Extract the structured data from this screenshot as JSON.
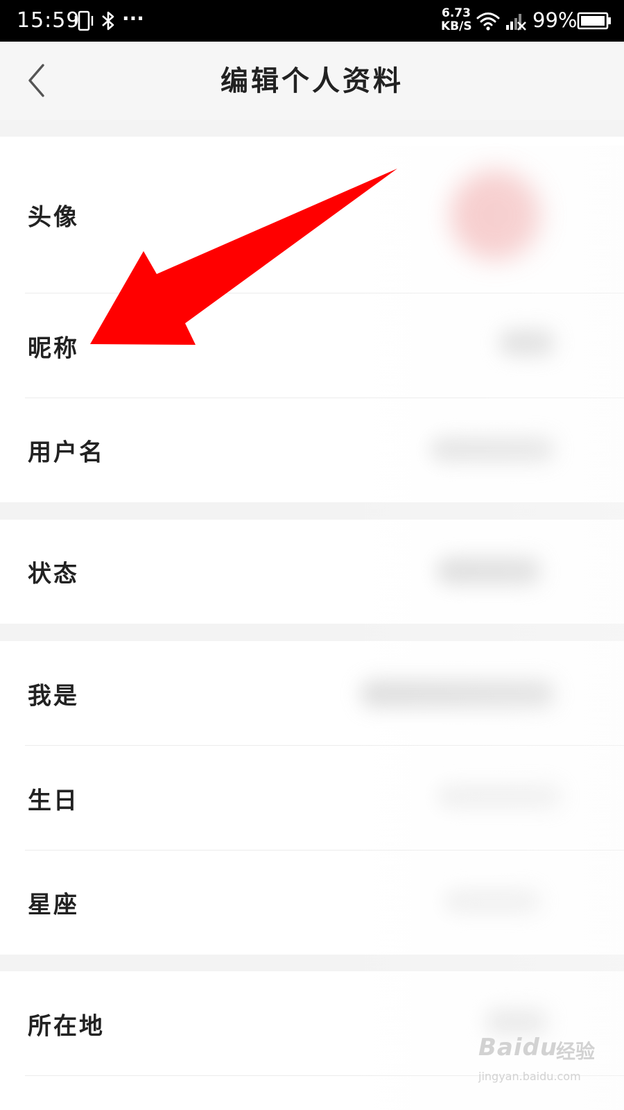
{
  "status_bar": {
    "time": "15:59",
    "more_dots": "···",
    "speed_value": "6.73",
    "speed_unit": "KB/S",
    "battery_percent": "99%",
    "icons": [
      "vibrate-icon",
      "bluetooth-icon",
      "wifi-icon",
      "signal-no-sim-icon",
      "battery-icon"
    ]
  },
  "header": {
    "title": "编辑个人资料",
    "back_icon": "chevron-left-icon"
  },
  "rows": [
    {
      "label": "头像"
    },
    {
      "label": "昵称"
    },
    {
      "label": "用户名"
    },
    {
      "label": "状态"
    },
    {
      "label": "我是"
    },
    {
      "label": "生日"
    },
    {
      "label": "星座"
    },
    {
      "label": "所在地"
    }
  ],
  "annotation": {
    "arrow_color": "#ff0000",
    "points_to": "昵称"
  },
  "watermark": {
    "logo": "Bai",
    "logo_mark": "du",
    "brand": "经验",
    "url": "jingyan.baidu.com"
  },
  "colors": {
    "status_bar_bg": "#000000",
    "header_bg": "#f6f6f6",
    "gap_bg": "#f3f3f3",
    "text": "#222222",
    "arrow": "#ff0000"
  }
}
